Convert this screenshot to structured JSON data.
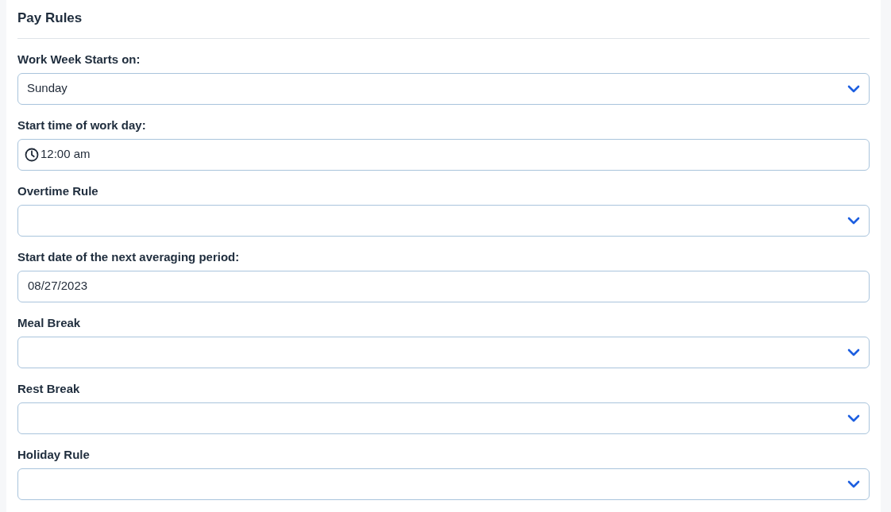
{
  "title": "Pay Rules",
  "fields": [
    {
      "label": "Work Week Starts on:",
      "kind": "select",
      "value": "Sunday"
    },
    {
      "label": "Start time of work day:",
      "kind": "time",
      "value": "12:00 am"
    },
    {
      "label": "Overtime Rule",
      "kind": "select"
    },
    {
      "label": "Start date of the next averaging period:",
      "kind": "text",
      "value": "08/27/2023"
    },
    {
      "label": "Meal Break",
      "kind": "select"
    },
    {
      "label": "Rest Break",
      "kind": "select"
    },
    {
      "label": "Holiday Rule",
      "kind": "select"
    }
  ]
}
